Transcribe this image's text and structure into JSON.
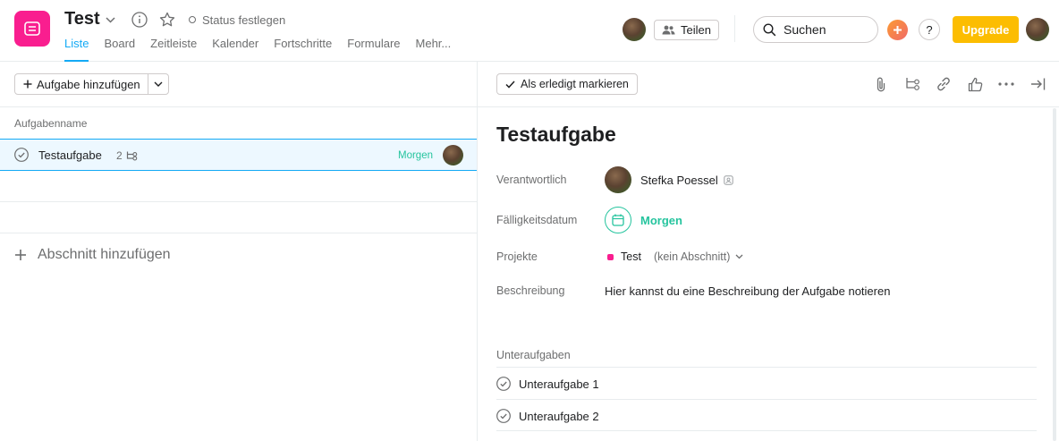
{
  "header": {
    "project_title": "Test",
    "status_label": "Status festlegen",
    "tabs": [
      {
        "label": "Liste",
        "active": true
      },
      {
        "label": "Board",
        "active": false
      },
      {
        "label": "Zeitleiste",
        "active": false
      },
      {
        "label": "Kalender",
        "active": false
      },
      {
        "label": "Fortschritte",
        "active": false
      },
      {
        "label": "Formulare",
        "active": false
      },
      {
        "label": "Mehr...",
        "active": false
      }
    ],
    "share_label": "Teilen",
    "search_placeholder": "Suchen",
    "help_label": "?",
    "upgrade_label": "Upgrade",
    "colors": {
      "brand": "#f91e8f",
      "active_tab": "#14aaf5",
      "upgrade": "#fcbd01",
      "due": "#25c49e"
    }
  },
  "list": {
    "add_task_label": "Aufgabe hinzufügen",
    "column_header": "Aufgabenname",
    "tasks": [
      {
        "name": "Testaufgabe",
        "subtask_count": "2",
        "due": "Morgen"
      }
    ],
    "add_section_label": "Abschnitt hinzufügen"
  },
  "detail": {
    "mark_done_label": "Als erledigt markieren",
    "toolbar_icons": [
      "attachment-icon",
      "subtask-icon",
      "link-icon",
      "like-icon",
      "more-icon",
      "close-pane-icon"
    ],
    "title": "Testaufgabe",
    "fields": {
      "assignee_label": "Verantwortlich",
      "assignee_name": "Stefka Poessel",
      "due_label": "Fälligkeitsdatum",
      "due_value": "Morgen",
      "projects_label": "Projekte",
      "project_name": "Test",
      "project_section": "(kein Abschnitt)",
      "description_label": "Beschreibung",
      "description_value": "Hier kannst du eine Beschreibung der Aufgabe notieren"
    },
    "subtasks_label": "Unteraufgaben",
    "subtasks": [
      {
        "name": "Unteraufgabe 1"
      },
      {
        "name": "Unteraufgabe 2"
      }
    ]
  }
}
